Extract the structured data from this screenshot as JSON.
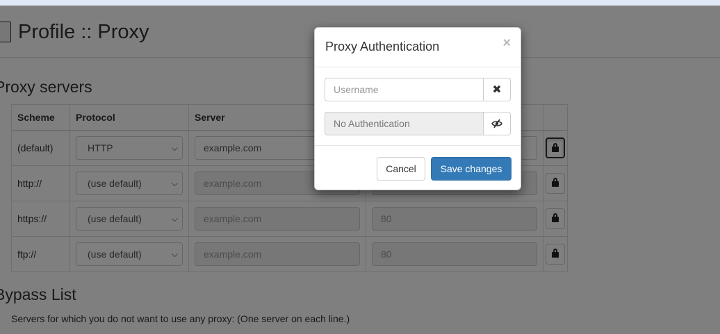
{
  "page": {
    "title": "Profile :: Proxy",
    "proxy_heading": "Proxy servers",
    "bypass_heading": "Bypass List",
    "bypass_description": "Servers for which you do not want to use any proxy: (One server on each line.)"
  },
  "table": {
    "headers": {
      "scheme": "Scheme",
      "protocol": "Protocol",
      "server": "Server",
      "port": "",
      "auth": ""
    },
    "rows": [
      {
        "scheme": "(default)",
        "protocol": "HTTP",
        "server": "example.com",
        "port": "",
        "server_readonly": false
      },
      {
        "scheme": "http://",
        "protocol": "(use default)",
        "server": "example.com",
        "port": "",
        "server_readonly": true
      },
      {
        "scheme": "https://",
        "protocol": "(use default)",
        "server": "example.com",
        "port": "80",
        "server_readonly": true
      },
      {
        "scheme": "ftp://",
        "protocol": "(use default)",
        "server": "example.com",
        "port": "80",
        "server_readonly": true
      }
    ]
  },
  "modal": {
    "title": "Proxy Authentication",
    "close_symbol": "×",
    "username_placeholder": "Username",
    "clear_symbol": "✖",
    "password_value": "No Authentication",
    "toggle_icon": "eye-slash-icon",
    "cancel_label": "Cancel",
    "save_label": "Save changes"
  },
  "colors": {
    "primary": "#337ab7",
    "backdrop": "rgba(0,0,0,0.5)"
  }
}
